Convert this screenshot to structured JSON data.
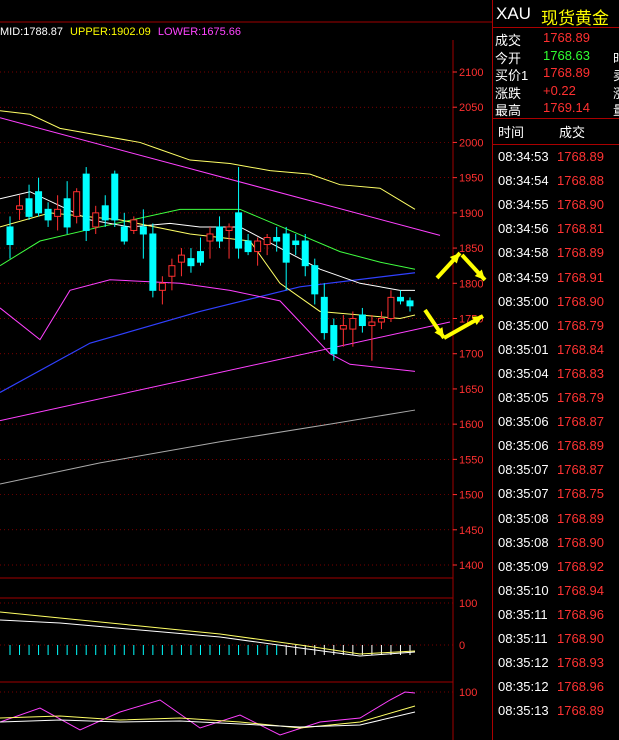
{
  "chart_data": {
    "type": "candlestick",
    "indicator": {
      "mid_label": "MID:1788.87",
      "upper_label": "UPPER:1902.09",
      "lower_label": "LOWER:1675.66"
    },
    "y_ticks": [
      2100,
      2050,
      2000,
      1950,
      1900,
      1850,
      1800,
      1750,
      1700,
      1650,
      1600,
      1550,
      1500,
      1450,
      1400
    ],
    "ylim": [
      1375,
      2125
    ],
    "sub1_ticks": [
      "100",
      "0"
    ],
    "sub2_ticks": [
      "100"
    ],
    "candles": [
      {
        "o": 1880,
        "h": 1895,
        "l": 1835,
        "c": 1855
      },
      {
        "o": 1905,
        "h": 1925,
        "l": 1890,
        "c": 1910
      },
      {
        "o": 1920,
        "h": 1940,
        "l": 1890,
        "c": 1895
      },
      {
        "o": 1930,
        "h": 1950,
        "l": 1895,
        "c": 1900
      },
      {
        "o": 1905,
        "h": 1915,
        "l": 1880,
        "c": 1890
      },
      {
        "o": 1895,
        "h": 1925,
        "l": 1875,
        "c": 1905
      },
      {
        "o": 1920,
        "h": 1945,
        "l": 1870,
        "c": 1880
      },
      {
        "o": 1895,
        "h": 1935,
        "l": 1885,
        "c": 1930
      },
      {
        "o": 1955,
        "h": 1965,
        "l": 1860,
        "c": 1875
      },
      {
        "o": 1880,
        "h": 1910,
        "l": 1870,
        "c": 1900
      },
      {
        "o": 1910,
        "h": 1925,
        "l": 1880,
        "c": 1890
      },
      {
        "o": 1955,
        "h": 1960,
        "l": 1880,
        "c": 1890
      },
      {
        "o": 1880,
        "h": 1900,
        "l": 1855,
        "c": 1860
      },
      {
        "o": 1875,
        "h": 1895,
        "l": 1870,
        "c": 1890
      },
      {
        "o": 1880,
        "h": 1905,
        "l": 1835,
        "c": 1870
      },
      {
        "o": 1870,
        "h": 1885,
        "l": 1780,
        "c": 1790
      },
      {
        "o": 1790,
        "h": 1810,
        "l": 1770,
        "c": 1800
      },
      {
        "o": 1810,
        "h": 1835,
        "l": 1790,
        "c": 1825
      },
      {
        "o": 1830,
        "h": 1850,
        "l": 1810,
        "c": 1840
      },
      {
        "o": 1835,
        "h": 1850,
        "l": 1815,
        "c": 1825
      },
      {
        "o": 1845,
        "h": 1865,
        "l": 1825,
        "c": 1830
      },
      {
        "o": 1860,
        "h": 1880,
        "l": 1835,
        "c": 1870
      },
      {
        "o": 1880,
        "h": 1895,
        "l": 1850,
        "c": 1860
      },
      {
        "o": 1875,
        "h": 1885,
        "l": 1835,
        "c": 1880
      },
      {
        "o": 1900,
        "h": 1965,
        "l": 1835,
        "c": 1850
      },
      {
        "o": 1860,
        "h": 1870,
        "l": 1840,
        "c": 1845
      },
      {
        "o": 1845,
        "h": 1865,
        "l": 1825,
        "c": 1860
      },
      {
        "o": 1855,
        "h": 1870,
        "l": 1840,
        "c": 1865
      },
      {
        "o": 1865,
        "h": 1880,
        "l": 1845,
        "c": 1860
      },
      {
        "o": 1870,
        "h": 1880,
        "l": 1790,
        "c": 1830
      },
      {
        "o": 1860,
        "h": 1870,
        "l": 1840,
        "c": 1855
      },
      {
        "o": 1860,
        "h": 1870,
        "l": 1810,
        "c": 1825
      },
      {
        "o": 1825,
        "h": 1835,
        "l": 1770,
        "c": 1785
      },
      {
        "o": 1780,
        "h": 1800,
        "l": 1720,
        "c": 1730
      },
      {
        "o": 1740,
        "h": 1750,
        "l": 1690,
        "c": 1700
      },
      {
        "o": 1735,
        "h": 1755,
        "l": 1710,
        "c": 1740
      },
      {
        "o": 1735,
        "h": 1760,
        "l": 1710,
        "c": 1750
      },
      {
        "o": 1755,
        "h": 1765,
        "l": 1730,
        "c": 1740
      },
      {
        "o": 1740,
        "h": 1755,
        "l": 1690,
        "c": 1745
      },
      {
        "o": 1745,
        "h": 1760,
        "l": 1735,
        "c": 1750
      },
      {
        "o": 1750,
        "h": 1790,
        "l": 1745,
        "c": 1780
      },
      {
        "o": 1780,
        "h": 1790,
        "l": 1770,
        "c": 1775
      },
      {
        "o": 1775,
        "h": 1780,
        "l": 1760,
        "c": 1768
      }
    ]
  },
  "quote": {
    "symbol": "XAU",
    "name": "现货黄金",
    "rows": [
      {
        "label": "成交",
        "value": "1768.89",
        "extra": "",
        "color": "#ff3030"
      },
      {
        "label": "今开",
        "value": "1768.63",
        "extra": "时",
        "color": "#30ff30"
      },
      {
        "label": "买价1",
        "value": "1768.89",
        "extra": "卖",
        "color": "#ff3030"
      },
      {
        "label": "涨跌",
        "value": "+0.22",
        "extra": "涨",
        "color": "#ff3030"
      },
      {
        "label": "最高",
        "value": "1769.14",
        "extra": "量",
        "color": "#ff3030"
      }
    ]
  },
  "ticks": {
    "time_header": "时间",
    "price_header": "成交",
    "rows": [
      {
        "t": "08:34:53",
        "p": "1768.89"
      },
      {
        "t": "08:34:54",
        "p": "1768.88"
      },
      {
        "t": "08:34:55",
        "p": "1768.90"
      },
      {
        "t": "08:34:56",
        "p": "1768.81"
      },
      {
        "t": "08:34:58",
        "p": "1768.89"
      },
      {
        "t": "08:34:59",
        "p": "1768.91"
      },
      {
        "t": "08:35:00",
        "p": "1768.90"
      },
      {
        "t": "08:35:00",
        "p": "1768.79"
      },
      {
        "t": "08:35:01",
        "p": "1768.84"
      },
      {
        "t": "08:35:04",
        "p": "1768.83"
      },
      {
        "t": "08:35:05",
        "p": "1768.79"
      },
      {
        "t": "08:35:06",
        "p": "1768.87"
      },
      {
        "t": "08:35:06",
        "p": "1768.89"
      },
      {
        "t": "08:35:07",
        "p": "1768.87"
      },
      {
        "t": "08:35:07",
        "p": "1768.75"
      },
      {
        "t": "08:35:08",
        "p": "1768.89"
      },
      {
        "t": "08:35:08",
        "p": "1768.90"
      },
      {
        "t": "08:35:09",
        "p": "1768.92"
      },
      {
        "t": "08:35:10",
        "p": "1768.94"
      },
      {
        "t": "08:35:11",
        "p": "1768.96"
      },
      {
        "t": "08:35:11",
        "p": "1768.90"
      },
      {
        "t": "08:35:12",
        "p": "1768.93"
      },
      {
        "t": "08:35:12",
        "p": "1768.96"
      },
      {
        "t": "08:35:13",
        "p": "1768.89"
      }
    ]
  },
  "colors": {
    "up": "#ff3030",
    "down": "#00ffff",
    "grid": "#a00000",
    "axis": "#ff3030",
    "magenta": "#ff40ff",
    "yellow": "#ffff66",
    "green": "#40ff40",
    "blue": "#3040ff",
    "gray": "#aaaaaa",
    "arrow": "#ffff00"
  }
}
